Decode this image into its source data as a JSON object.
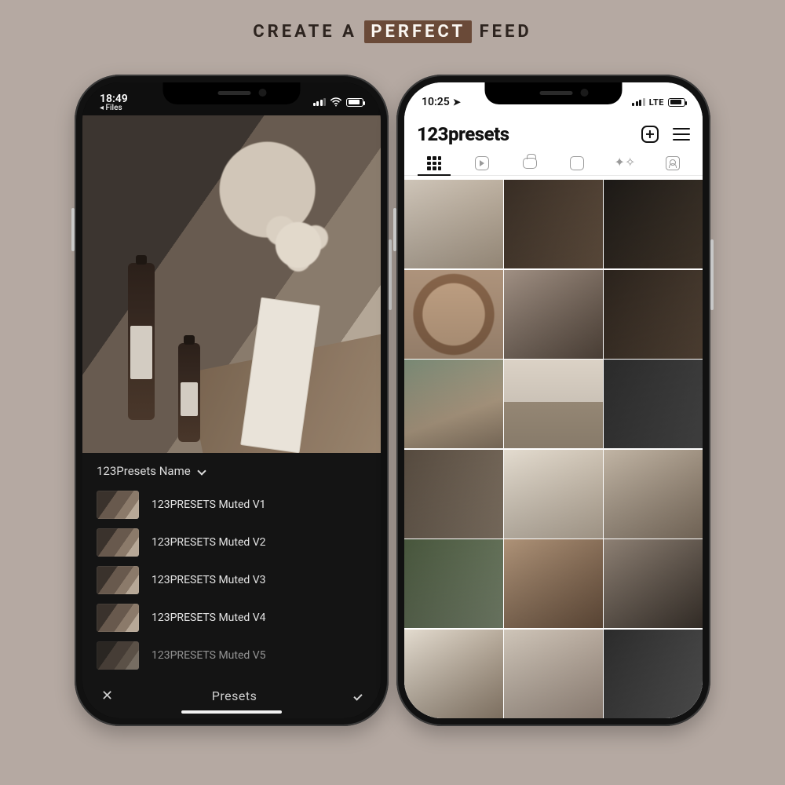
{
  "headline": {
    "pre": "CREATE A",
    "highlight": "PERFECT",
    "post": "FEED"
  },
  "leftPhone": {
    "status": {
      "time": "18:49",
      "back": "◂ Files"
    },
    "presetsHeader": "123Presets Name",
    "presets": [
      {
        "label": "123PRESETS Muted V1"
      },
      {
        "label": "123PRESETS Muted V2"
      },
      {
        "label": "123PRESETS Muted V3"
      },
      {
        "label": "123PRESETS Muted V4"
      },
      {
        "label": "123PRESETS Muted V5"
      }
    ],
    "bottomTitle": "Presets"
  },
  "rightPhone": {
    "status": {
      "time": "10:25",
      "network": "LTE"
    },
    "username": "123presets"
  }
}
